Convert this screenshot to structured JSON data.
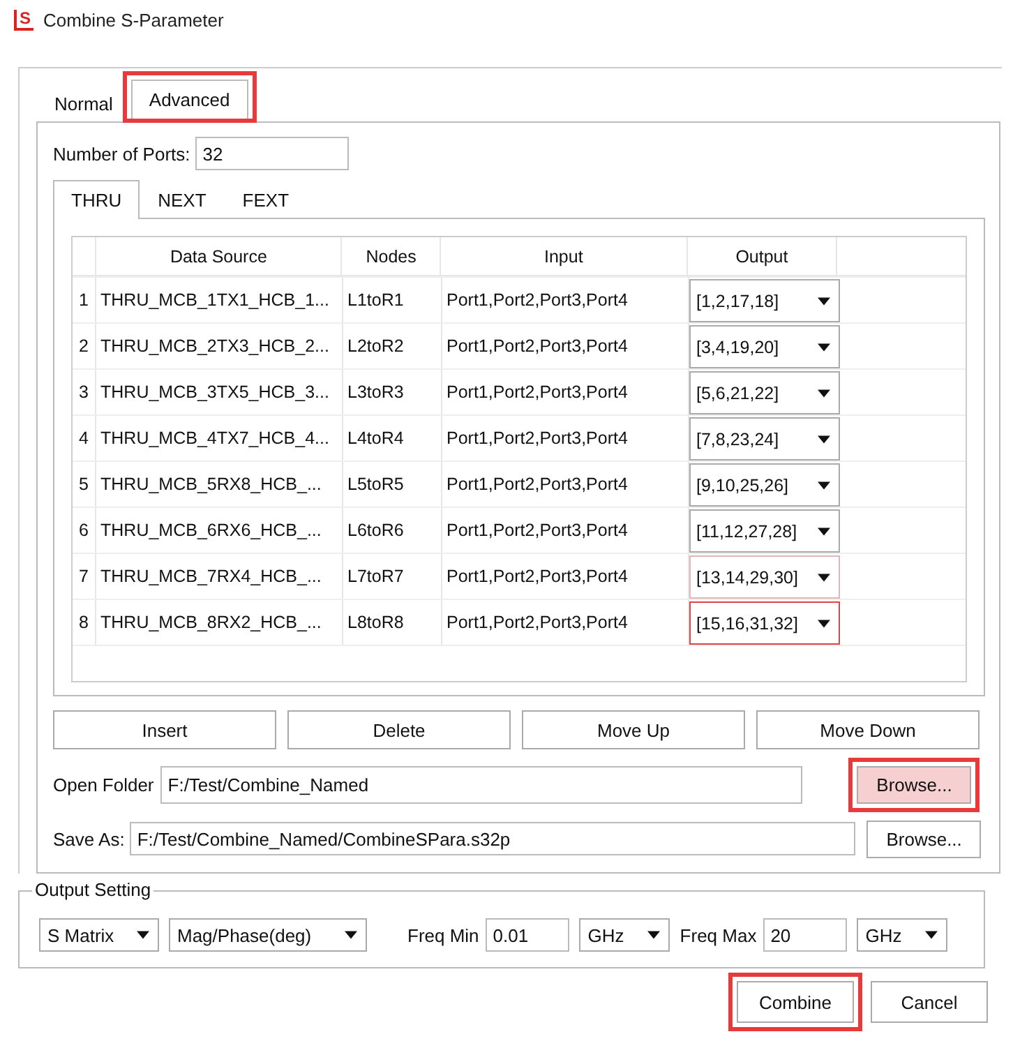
{
  "window": {
    "title": "Combine S-Parameter",
    "icon_letter": "S"
  },
  "tabs": [
    {
      "label": "Normal",
      "selected": false,
      "highlighted": false
    },
    {
      "label": "Advanced",
      "selected": true,
      "highlighted": true
    }
  ],
  "number_of_ports": {
    "label": "Number of Ports:",
    "value": "32"
  },
  "sub_tabs": [
    {
      "label": "THRU",
      "selected": true
    },
    {
      "label": "NEXT",
      "selected": false
    },
    {
      "label": "FEXT",
      "selected": false
    }
  ],
  "table": {
    "columns": [
      "Data Source",
      "Nodes",
      "Input",
      "Output"
    ],
    "rows": [
      {
        "index": "1",
        "data_source": "THRU_MCB_1TX1_HCB_1...",
        "nodes": "L1toR1",
        "input": "Port1,Port2,Port3,Port4",
        "output": "[1,2,17,18]",
        "hovered": false,
        "focused": false
      },
      {
        "index": "2",
        "data_source": "THRU_MCB_2TX3_HCB_2...",
        "nodes": "L2toR2",
        "input": "Port1,Port2,Port3,Port4",
        "output": "[3,4,19,20]",
        "hovered": false,
        "focused": false
      },
      {
        "index": "3",
        "data_source": "THRU_MCB_3TX5_HCB_3...",
        "nodes": "L3toR3",
        "input": "Port1,Port2,Port3,Port4",
        "output": "[5,6,21,22]",
        "hovered": false,
        "focused": false
      },
      {
        "index": "4",
        "data_source": "THRU_MCB_4TX7_HCB_4...",
        "nodes": "L4toR4",
        "input": "Port1,Port2,Port3,Port4",
        "output": "[7,8,23,24]",
        "hovered": false,
        "focused": false
      },
      {
        "index": "5",
        "data_source": "THRU_MCB_5RX8_HCB_...",
        "nodes": "L5toR5",
        "input": "Port1,Port2,Port3,Port4",
        "output": "[9,10,25,26]",
        "hovered": false,
        "focused": false
      },
      {
        "index": "6",
        "data_source": "THRU_MCB_6RX6_HCB_...",
        "nodes": "L6toR6",
        "input": "Port1,Port2,Port3,Port4",
        "output": "[11,12,27,28]",
        "hovered": false,
        "focused": false
      },
      {
        "index": "7",
        "data_source": "THRU_MCB_7RX4_HCB_...",
        "nodes": "L7toR7",
        "input": "Port1,Port2,Port3,Port4",
        "output": "[13,14,29,30]",
        "hovered": true,
        "focused": false
      },
      {
        "index": "8",
        "data_source": "THRU_MCB_8RX2_HCB_...",
        "nodes": "L8toR8",
        "input": "Port1,Port2,Port3,Port4",
        "output": "[15,16,31,32]",
        "hovered": false,
        "focused": true
      }
    ]
  },
  "row_buttons": [
    "Insert",
    "Delete",
    "Move Up",
    "Move Down"
  ],
  "open_folder": {
    "label": "Open Folder",
    "value": "F:/Test/Combine_Named",
    "button": "Browse...",
    "hovered": true,
    "highlighted": true
  },
  "save_as": {
    "label": "Save As:",
    "value": "F:/Test/Combine_Named/CombineSPara.s32p",
    "button": "Browse...",
    "hovered": false,
    "highlighted": false
  },
  "output_setting": {
    "title": "Output Setting",
    "matrix": "S Matrix",
    "format": "Mag/Phase(deg)",
    "freq_min_label": "Freq Min",
    "freq_min": "0.01",
    "freq_min_unit": "GHz",
    "freq_max_label": "Freq Max",
    "freq_max": "20",
    "freq_max_unit": "GHz"
  },
  "buttons": [
    {
      "label": "Combine",
      "highlighted": true
    },
    {
      "label": "Cancel",
      "highlighted": false
    }
  ]
}
